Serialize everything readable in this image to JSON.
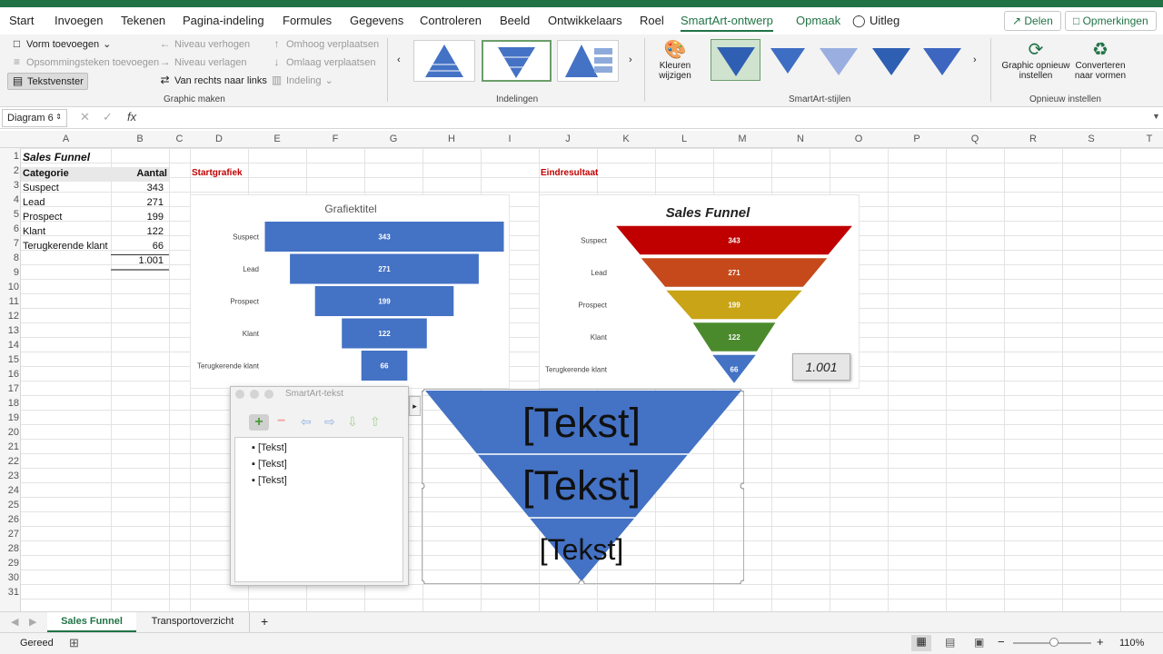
{
  "tabs": [
    "Start",
    "Invoegen",
    "Tekenen",
    "Pagina-indeling",
    "Formules",
    "Gegevens",
    "Controleren",
    "Beeld",
    "Ontwikkelaars",
    "Roel",
    "SmartArt-ontwerp",
    "Opmaak",
    "Uitleg"
  ],
  "topbuttons": {
    "share": "Delen",
    "comments": "Opmerkingen"
  },
  "ribbon": {
    "add_shape": "Vorm toevoegen",
    "add_bullet": "Opsommingsteken toevoegen",
    "text_pane": "Tekstvenster",
    "promote": "Niveau verhogen",
    "demote": "Niveau verlagen",
    "rtl": "Van rechts naar links",
    "move_up": "Omhoog verplaatsen",
    "move_down": "Omlaag verplaatsen",
    "layout": "Indeling",
    "group_create": "Graphic maken",
    "group_layouts": "Indelingen",
    "colors": "Kleuren wijzigen",
    "group_styles": "SmartArt-stijlen",
    "reset": "Graphic opnieuw instellen",
    "convert": "Converteren naar vormen",
    "group_reset": "Opnieuw instellen"
  },
  "formula": {
    "namebox": "Diagram 6",
    "fx": "fx"
  },
  "columns": [
    "A",
    "B",
    "C",
    "D",
    "E",
    "F",
    "G",
    "H",
    "I",
    "J",
    "K",
    "L",
    "M",
    "N",
    "O",
    "P",
    "Q",
    "R",
    "S",
    "T"
  ],
  "rows": [
    "1",
    "2",
    "3",
    "4",
    "5",
    "6",
    "7",
    "8",
    "9",
    "10",
    "11",
    "12",
    "13",
    "14",
    "15",
    "16",
    "17",
    "18",
    "19",
    "20",
    "21",
    "22",
    "23",
    "24",
    "25",
    "26",
    "27",
    "28",
    "29",
    "30",
    "31"
  ],
  "sheet": {
    "title": "Sales Funnel",
    "header_cat": "Categorie",
    "header_val": "Aantal",
    "rows": [
      [
        "Suspect",
        "343"
      ],
      [
        "Lead",
        "271"
      ],
      [
        "Prospect",
        "199"
      ],
      [
        "Klant",
        "122"
      ],
      [
        "Terugkerende klant",
        "66"
      ]
    ],
    "total": "1.001",
    "label_start": "Startgrafiek",
    "label_end": "Eindresultaat"
  },
  "chart_data": [
    {
      "type": "bar",
      "title": "Grafiektitel",
      "categories": [
        "Suspect",
        "Lead",
        "Prospect",
        "Klant",
        "Terugkerende klant"
      ],
      "values": [
        343,
        271,
        199,
        122,
        66
      ],
      "color": "#4472c4"
    },
    {
      "type": "bar",
      "title": "Sales Funnel",
      "categories": [
        "Suspect",
        "Lead",
        "Prospect",
        "Klant",
        "Terugkerende klant"
      ],
      "values": [
        343,
        271,
        199,
        122,
        66
      ],
      "colors": [
        "#c00000",
        "#c5491b",
        "#c8a416",
        "#4a8a2c",
        "#4472c4"
      ],
      "total": "1.001"
    }
  ],
  "pane": {
    "title": "SmartArt-tekst",
    "items": [
      "[Tekst]",
      "[Tekst]",
      "[Tekst]"
    ]
  },
  "smartart": {
    "items": [
      "[Tekst]",
      "[Tekst]",
      "[Tekst]"
    ],
    "color": "#4472c4"
  },
  "sheets": {
    "active": "Sales Funnel",
    "other": "Transportoverzicht",
    "add": "+"
  },
  "status": {
    "ready": "Gereed",
    "zoom": "110%"
  }
}
